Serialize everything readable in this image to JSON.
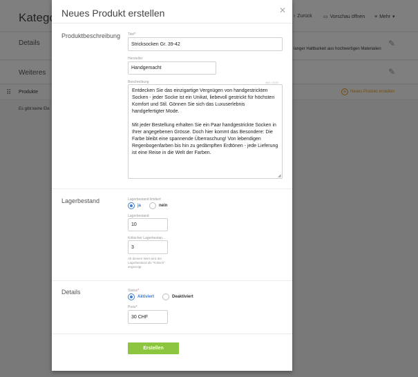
{
  "background": {
    "page_title": "Kategor",
    "toolbar": {
      "back": "Zurück",
      "preview": "Vorschau öffnen",
      "more": "Mehr"
    },
    "sections": {
      "details": "Details",
      "more": "Weiteres"
    },
    "details_text": "langer Haltbarkeit aus hochwertigen Materialien",
    "products_label": "Produkte",
    "add_product": "Neues Produkt erstellen",
    "empty_text": "Es gibt keine Ele"
  },
  "modal": {
    "title": "Neues Produkt erstellen",
    "close_icon": "close-icon",
    "description_section": {
      "label": "Produktbeschreibung",
      "title_label": "Titel",
      "title_value": "Stricksocken Gr. 39-42",
      "maker_label": "Hersteller",
      "maker_value": "Handgemacht",
      "desc_label": "Beschreibung",
      "desc_counter": "466 / 2000",
      "desc_p1": "Entdecken Sie das einzigartige Vergnügen von handgestrickten Socken - jeder Socke ist ein Unikat, liebevoll gestrickt für höchsten Komfort und Stil. Gönnen Sie sich das Luxuserlebnis handgefertigter Mode.",
      "desc_p2": "Mit jeder Bestellung erhalten Sie ein Paar handgestrickte Socken in Ihrer angegebenen Grösse. Doch hier kommt das Besondere: Die Farbe bleibt eine spannende Überraschung! Von lebendigen Regenbogenfarben bis hin zu gedämpften Erdtönen - jede Lieferung ist eine Reise in die Welt der Farben."
    },
    "stock_section": {
      "label": "Lagerbestand",
      "limited_label": "Lagerbestand limitiert",
      "yes": "ja",
      "no": "nein",
      "stock_label": "Lagerbestand",
      "stock_value": "10",
      "critical_label": "Kritischer Lagerbestan...",
      "critical_value": "3",
      "hint": "Ab diesem Wert wird der Lagerbestand als \"Kritisch\" angezeigt."
    },
    "details_section": {
      "label": "Details",
      "status_label": "Status",
      "active": "Aktiviert",
      "inactive": "Deaktiviert",
      "price_label": "Preis",
      "price_value": "30 CHF"
    },
    "submit": "Erstellen"
  }
}
